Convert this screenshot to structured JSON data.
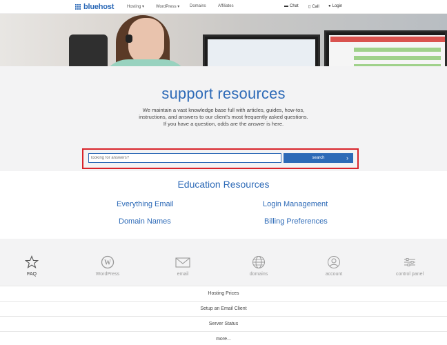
{
  "nav": {
    "logo_text": "bluehost",
    "items": [
      "Hosting",
      "WordPress",
      "Domains",
      "Affiliates"
    ],
    "chat": "Chat",
    "call": "Call",
    "login": "Login"
  },
  "support": {
    "title": "support resources",
    "description": "We maintain a vast knowledge base full with articles, guides, how-tos, instructions, and answers to our client's most frequently asked questions. If you have a question, odds are the answer is here.",
    "search_placeholder": "looking for answers?",
    "search_button": "search"
  },
  "education": {
    "title": "Education Resources",
    "links": [
      "Everything Email",
      "Login Management",
      "Domain Names",
      "Billing Preferences"
    ]
  },
  "categories": [
    {
      "label": "FAQ",
      "icon": "star-icon"
    },
    {
      "label": "WordPress",
      "icon": "wordpress-icon"
    },
    {
      "label": "email",
      "icon": "envelope-icon"
    },
    {
      "label": "domains",
      "icon": "globe-icon"
    },
    {
      "label": "account",
      "icon": "user-icon"
    },
    {
      "label": "control panel",
      "icon": "sliders-icon"
    }
  ],
  "faq_list": [
    "Hosting Prices",
    "Setup an Email Client",
    "Server Status",
    "more..."
  ],
  "colors": {
    "brand": "#2d6ab7",
    "highlight_frame": "#d9232a"
  }
}
